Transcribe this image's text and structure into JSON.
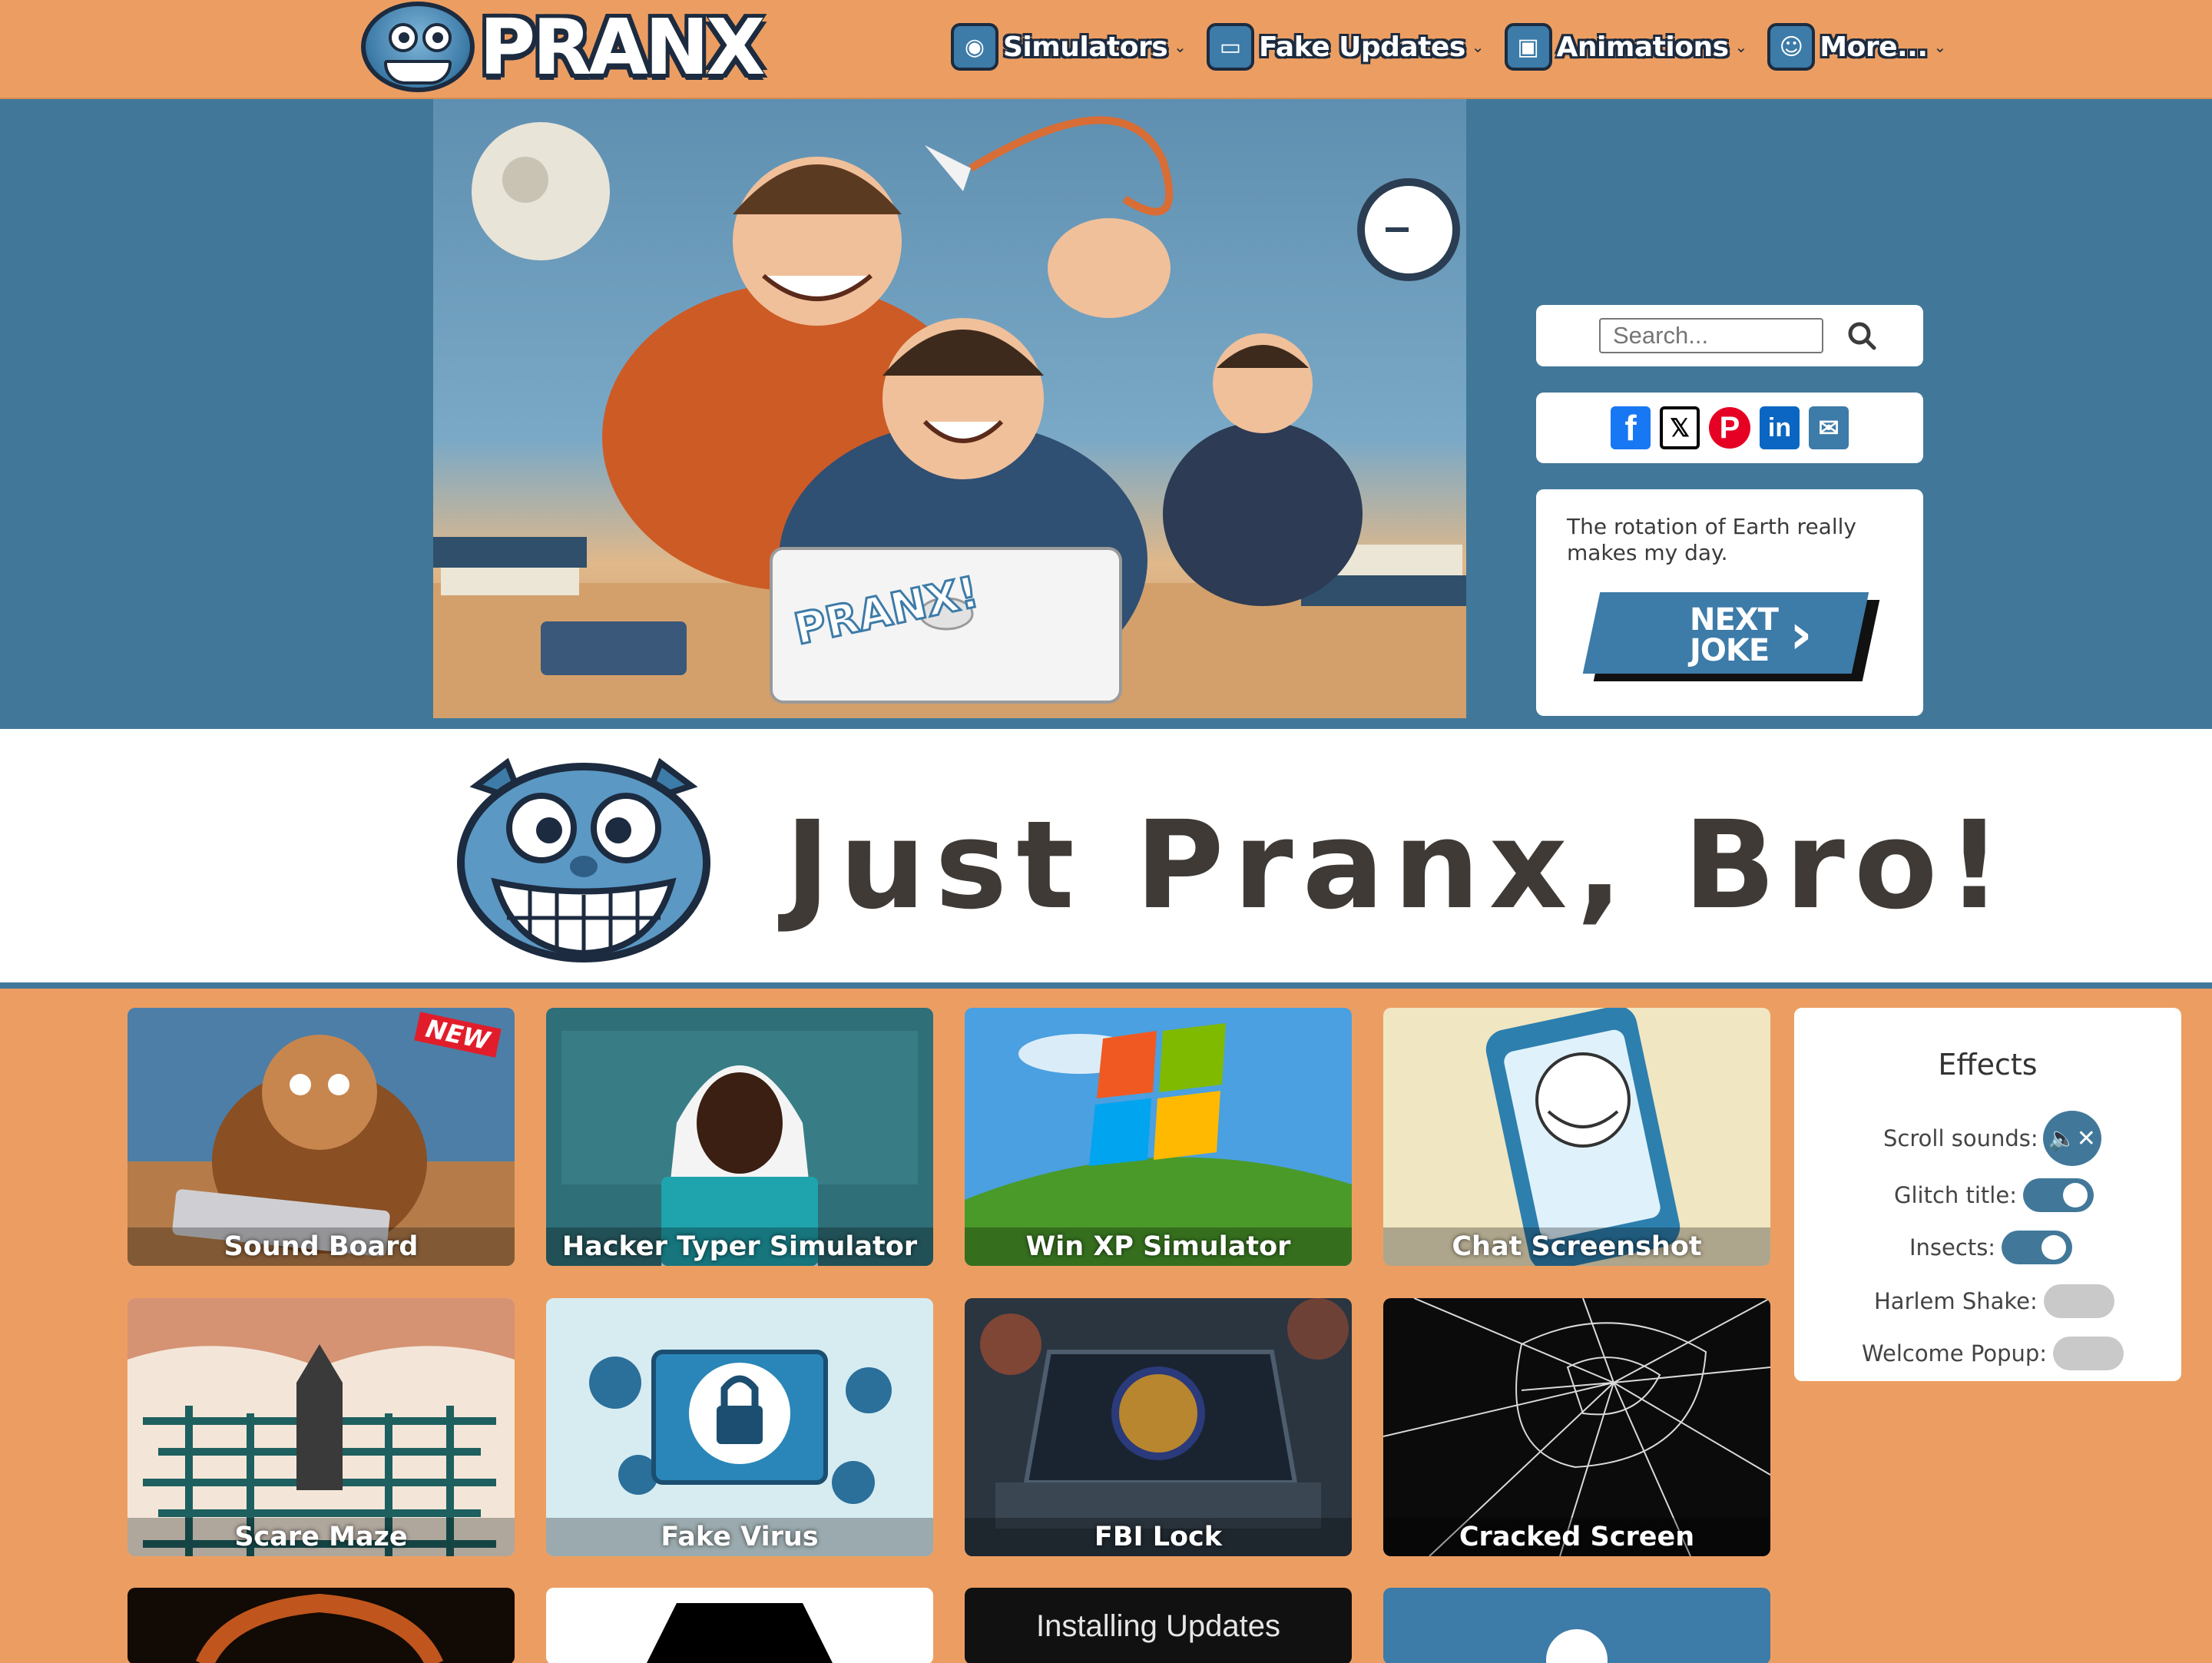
{
  "header": {
    "logo_text": "PRANX",
    "nav": [
      {
        "label": "Simulators",
        "icon": "steering-wheel-icon"
      },
      {
        "label": "Fake Updates",
        "icon": "toggle-icon"
      },
      {
        "label": "Animations",
        "icon": "tv-icon"
      },
      {
        "label": "More...",
        "icon": "robot-icon"
      }
    ]
  },
  "hero": {
    "laptop_sticker": "PRANX!"
  },
  "sidebar": {
    "search_placeholder": "Search...",
    "share_icons": [
      "facebook-icon",
      "x-icon",
      "pinterest-icon",
      "linkedin-icon",
      "email-icon"
    ],
    "joke": "The rotation of Earth really makes my day.",
    "next_joke_label": [
      "NEXT",
      "JOKE"
    ]
  },
  "title_band": {
    "title": "Just Pranx, Bro!"
  },
  "grid": {
    "new_badge": "NEW",
    "cards": [
      {
        "title": "Sound Board"
      },
      {
        "title": "Hacker Typer Simulator"
      },
      {
        "title": "Win XP Simulator"
      },
      {
        "title": "Chat Screenshot"
      },
      {
        "title": "Scare Maze"
      },
      {
        "title": "Fake Virus"
      },
      {
        "title": "FBI Lock"
      },
      {
        "title": "Cracked Screen"
      }
    ],
    "partial_card_text": "Installing Updates"
  },
  "effects": {
    "title": "Effects",
    "rows": [
      {
        "label": "Scroll sounds:",
        "state": "muted"
      },
      {
        "label": "Glitch title:",
        "state": "on"
      },
      {
        "label": "Insects:",
        "state": "on"
      },
      {
        "label": "Harlem Shake:",
        "state": "off"
      },
      {
        "label": "Welcome Popup:",
        "state": "off"
      }
    ]
  },
  "colors": {
    "page_orange": "#ec9e62",
    "brand_blue": "#41789a",
    "dark_navy": "#1c2b3f"
  }
}
